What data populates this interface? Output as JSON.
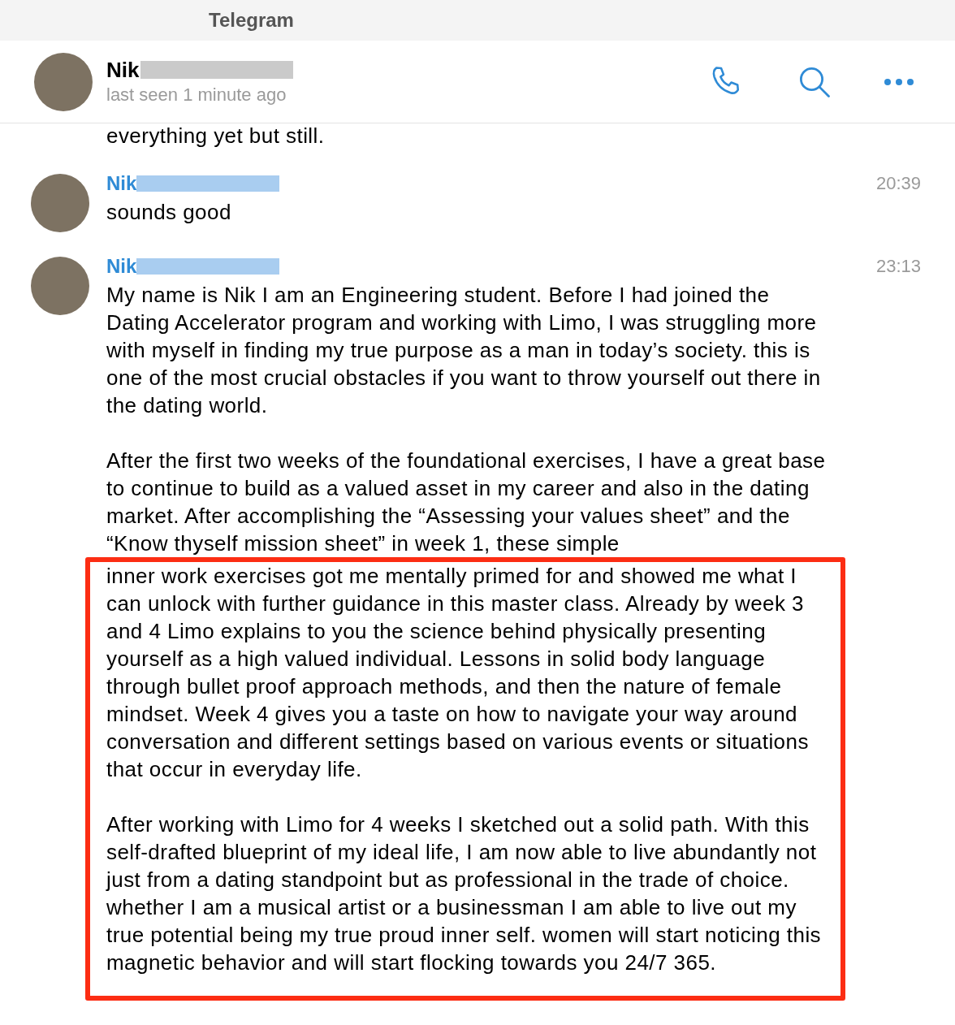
{
  "window": {
    "title": "Telegram"
  },
  "chat_header": {
    "name": "Nik",
    "status": "last seen 1 minute ago"
  },
  "messages": [
    {
      "kind": "continuation",
      "paragraphs": [
        {
          "text": "everything yet but still.",
          "highlighted": false
        }
      ]
    },
    {
      "kind": "message",
      "sender": "Nik",
      "time": "20:39",
      "paragraphs": [
        {
          "text": "sounds good",
          "highlighted": false
        }
      ]
    },
    {
      "kind": "message",
      "sender": "Nik",
      "time": "23:13",
      "paragraphs": [
        {
          "text": "My name is Nik I am an Engineering student. Before I had joined the Dating Accelerator program and working with Limo, I was struggling more with myself in finding my true purpose as a man in today’s society. this is one of the most crucial obstacles if you want to throw yourself out there in the dating world.",
          "highlighted": false
        },
        {
          "text": "After the first two weeks of the foundational exercises, I have a great base to continue to build as a valued asset in my career and also in the dating market. After accomplishing the “Assessing your values sheet” and the “Know thyself mission sheet” in week 1, these simple",
          "highlighted": false
        },
        {
          "text": "inner work exercises got me mentally primed for and showed me what I can unlock with further guidance in this master class. Already by week 3 and 4 Limo explains to you the science behind physically presenting yourself as a high valued individual. Lessons in solid body language through bullet proof approach methods, and then the nature of female mindset. Week 4 gives you a taste on how to navigate your way around conversation and different settings based on various events or situations that occur in everyday life.",
          "highlighted": true
        },
        {
          "text": "After working with Limo for 4 weeks I sketched out a solid path. With this self-drafted blueprint of my ideal life, I am now able to live abundantly not just from a dating standpoint but as professional in the trade of choice. whether I am a musical artist or a businessman I am able to live out my true potential being my true proud inner self. women will start noticing this magnetic behavior and will start flocking towards you 24/7 365.",
          "highlighted": true
        }
      ]
    }
  ]
}
